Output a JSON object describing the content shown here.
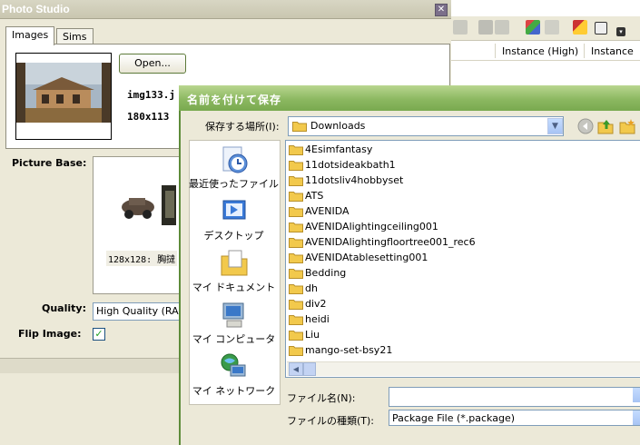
{
  "background_app": {
    "columns": [
      "Instance (High)",
      "Instance"
    ]
  },
  "photo_studio": {
    "title": "Photo Studio",
    "close_glyph": "✕",
    "tabs": [
      {
        "label": "Images",
        "selected": true
      },
      {
        "label": "Sims",
        "selected": false
      }
    ],
    "open_button": "Open...",
    "image_name": "img133.j",
    "image_size": "180x113",
    "picture_base_label": "Picture Base:",
    "picture_base_caption": "128x128: 胸撻",
    "quality_label": "Quality:",
    "quality_value": "High Quality (RA",
    "flip_label": "Flip Image:",
    "flip_checked": true,
    "check_glyph": "✓"
  },
  "save_dialog": {
    "title": "名前を付けて保存",
    "save_in_label": "保存する場所(I):",
    "save_in_value": "Downloads",
    "places": [
      {
        "label": "最近使ったファイル",
        "icon": "recent-files-icon"
      },
      {
        "label": "デスクトップ",
        "icon": "desktop-icon"
      },
      {
        "label": "マイ ドキュメント",
        "icon": "my-documents-icon"
      },
      {
        "label": "マイ コンピュータ",
        "icon": "my-computer-icon"
      },
      {
        "label": "マイ ネットワーク",
        "icon": "my-network-icon"
      }
    ],
    "files": [
      "4Esimfantasy",
      "11dotsideakbath1",
      "11dotsliv4hobbyset",
      "ATS",
      "AVENIDA",
      "AVENIDAlightingceiling001",
      "AVENIDAlightingfloortree001_rec6",
      "AVENIDAtablesetting001",
      "Bedding",
      "dh",
      "div2",
      "heidi",
      "Liu",
      "mango-set-bsy21"
    ],
    "file_name_label": "ファイル名(N):",
    "file_name_value": "",
    "file_type_label": "ファイルの種類(T):",
    "file_type_value": "Package File (*.package)",
    "scroll_left_glyph": "◀",
    "dropdown_glyph": "▼"
  },
  "colors": {
    "dialog_title": "#8cb861",
    "folder": "#f2c94c",
    "window_bg": "#ECE9D8"
  }
}
